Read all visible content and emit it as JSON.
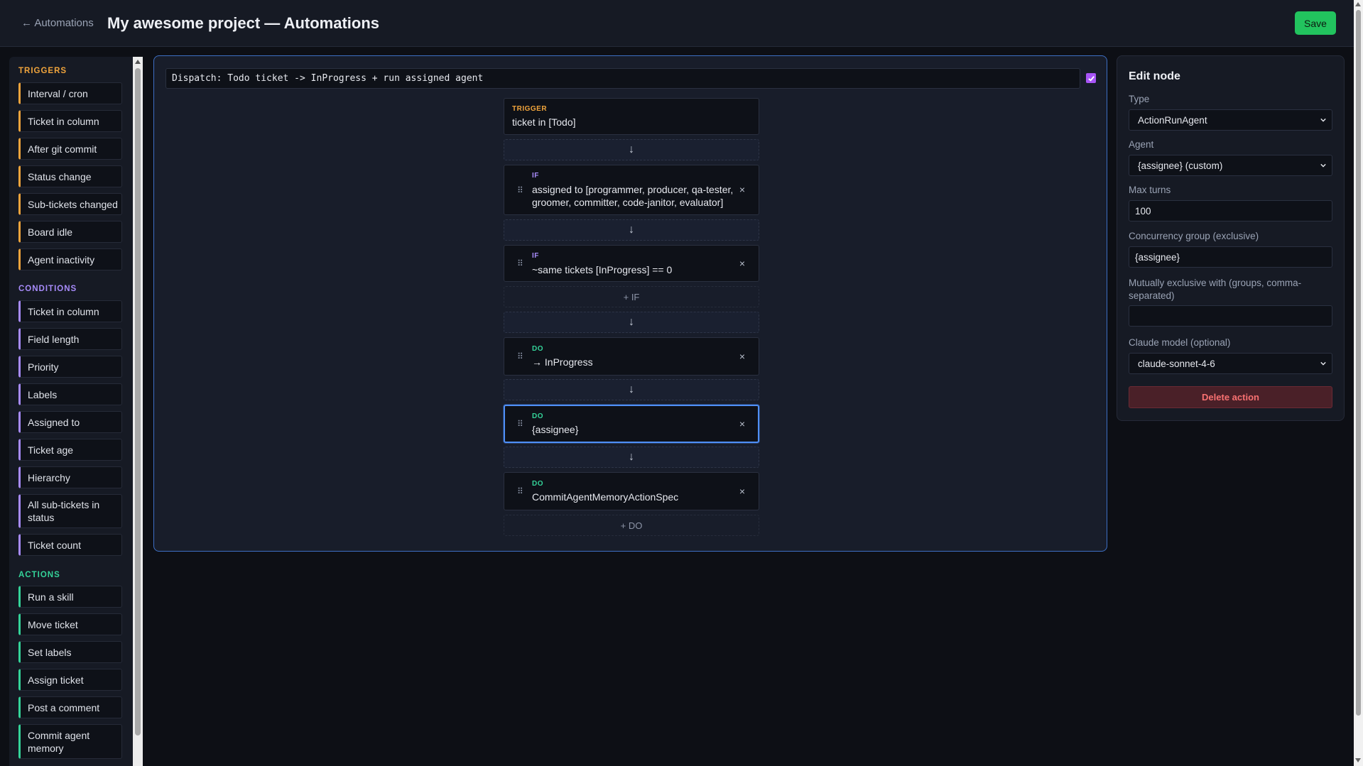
{
  "header": {
    "back_label": "← Automations",
    "title": "My awesome project — Automations",
    "save_label": "Save"
  },
  "palette": {
    "triggers_label": "TRIGGERS",
    "triggers": [
      "Interval / cron",
      "Ticket in column",
      "After git commit",
      "Status change",
      "Sub-tickets changed",
      "Board idle",
      "Agent inactivity"
    ],
    "conditions_label": "CONDITIONS",
    "conditions": [
      "Ticket in column",
      "Field length",
      "Priority",
      "Labels",
      "Assigned to",
      "Ticket age",
      "Hierarchy",
      "All sub-tickets in status",
      "Ticket count"
    ],
    "actions_label": "ACTIONS",
    "actions": [
      "Run a skill",
      "Move ticket",
      "Set labels",
      "Assign ticket",
      "Post a comment",
      "Commit agent memory"
    ]
  },
  "canvas": {
    "automation_name": "Dispatch: Todo ticket -> InProgress + run assigned agent",
    "enabled": true,
    "arrow": "↓",
    "handle": "⠿",
    "remove": "×",
    "trigger": {
      "kind": "TRIGGER",
      "summary": "ticket in [Todo]"
    },
    "conditions": [
      {
        "kind": "IF",
        "summary": "assigned to [programmer, producer, qa-tester, groomer, committer, code-janitor, evaluator]"
      },
      {
        "kind": "IF",
        "summary": "~same tickets [InProgress] == 0"
      }
    ],
    "add_if": "+ IF",
    "actions": [
      {
        "kind": "DO",
        "summary": "→ InProgress"
      },
      {
        "kind": "DO",
        "summary": "{assignee}"
      },
      {
        "kind": "DO",
        "summary": "CommitAgentMemoryActionSpec"
      }
    ],
    "add_do": "+ DO"
  },
  "edit": {
    "title": "Edit node",
    "type_label": "Type",
    "type_value": "ActionRunAgent",
    "agent_label": "Agent",
    "agent_value": "{assignee} (custom)",
    "max_turns_label": "Max turns",
    "max_turns_value": "100",
    "concurrency_label": "Concurrency group (exclusive)",
    "concurrency_value": "{assignee}",
    "mutex_label": "Mutually exclusive with (groups, comma-separated)",
    "mutex_value": "",
    "model_label": "Claude model (optional)",
    "model_value": "claude-sonnet-4-6",
    "delete_label": "Delete action"
  },
  "colors": {
    "trigger": "#f0a43c",
    "condition": "#a78bfa",
    "action": "#34d399",
    "accent": "#4f8ff7",
    "save": "#22c35e",
    "delete": "#f87171"
  },
  "icons": {
    "drag_handle": "drag-handle-icon",
    "remove": "close-icon",
    "arrow": "arrow-down-icon",
    "check": "check-icon",
    "chevron": "chevron-down-icon"
  }
}
